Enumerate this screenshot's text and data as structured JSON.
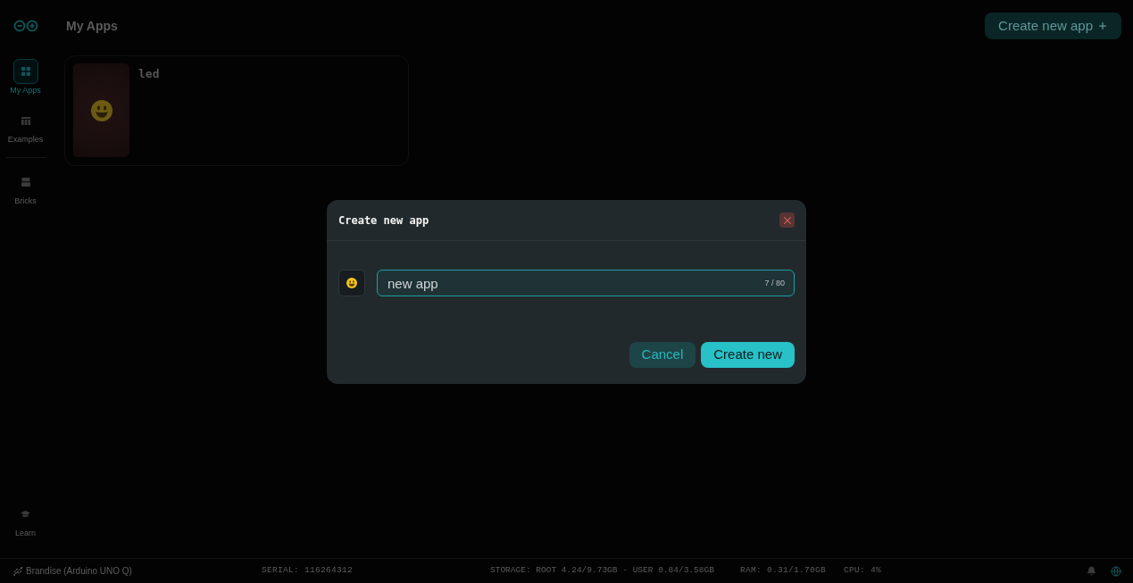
{
  "sidebar": {
    "groups": [
      [
        {
          "label": "My Apps",
          "selected": true
        },
        {
          "label": "Examples",
          "selected": false
        }
      ],
      [
        {
          "label": "Bricks",
          "selected": false
        }
      ]
    ],
    "bottom_items": [
      {
        "label": "Learn",
        "selected": false
      }
    ]
  },
  "header": {
    "title": "My Apps",
    "create_button": "Create new app"
  },
  "apps": [
    {
      "name": "led"
    }
  ],
  "dialog": {
    "title": "Create new app",
    "name_field": {
      "value": "new app",
      "counter": "7 / 80"
    },
    "buttons": [
      {
        "label": "Cancel",
        "kind": "secondary"
      },
      {
        "label": "Create new",
        "kind": "primary"
      }
    ]
  },
  "status_bar": {
    "device": "Brandise (Arduino UNO Q)",
    "serial": "SERIAL: 116264312",
    "storage": "STORAGE: ROOT 4.24/9.73GB - USER 0.84/3.58GB",
    "ram": "RAM: 0.31/1.70GB",
    "cpu": "CPU: 4%"
  }
}
